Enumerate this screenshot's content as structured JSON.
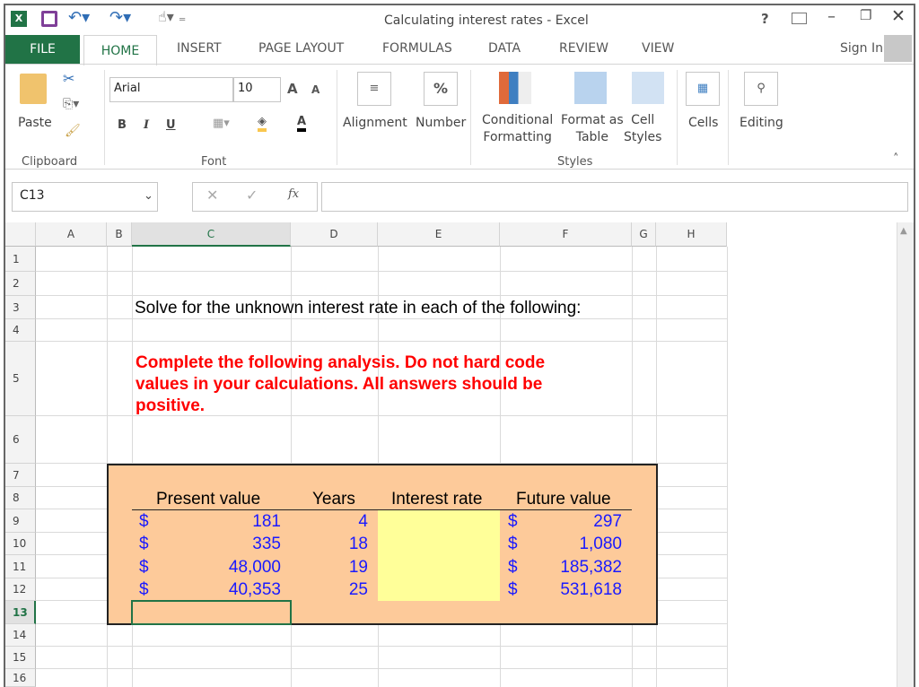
{
  "window": {
    "title": "Calculating interest rates - Excel",
    "sign_in": "Sign In"
  },
  "tabs": [
    "FILE",
    "HOME",
    "INSERT",
    "PAGE LAYOUT",
    "FORMULAS",
    "DATA",
    "REVIEW",
    "VIEW"
  ],
  "ribbon": {
    "paste": "Paste",
    "clipboard": "Clipboard",
    "font_name": "Arial",
    "font_size": "10",
    "bold": "B",
    "italic": "I",
    "underline": "U",
    "font": "Font",
    "alignment": "Alignment",
    "number": "Number",
    "percent": "%",
    "conditional": [
      "Conditional",
      "Formatting"
    ],
    "format_table": [
      "Format as",
      "Table"
    ],
    "cell_styles": [
      "Cell",
      "Styles"
    ],
    "styles": "Styles",
    "cells": "Cells",
    "editing": "Editing"
  },
  "formula_bar": {
    "name_box": "C13",
    "fx": "fx",
    "formula": ""
  },
  "columns": [
    "A",
    "B",
    "C",
    "D",
    "E",
    "F",
    "G",
    "H"
  ],
  "rows": [
    "1",
    "2",
    "3",
    "4",
    "5",
    "6",
    "7",
    "8",
    "9",
    "10",
    "11",
    "12",
    "13",
    "14",
    "15",
    "16"
  ],
  "sheet": {
    "instruction": "Solve for the unknown interest rate in each of the following:",
    "warning": "Complete the following analysis. Do not hard code values in your calculations. All answers should be positive.",
    "headers": [
      "Present value",
      "Years",
      "Interest rate",
      "Future value"
    ],
    "currency": "$",
    "table": [
      {
        "pv": "181",
        "years": "4",
        "rate": "",
        "fv": "297"
      },
      {
        "pv": "335",
        "years": "18",
        "rate": "",
        "fv": "1,080"
      },
      {
        "pv": "48,000",
        "years": "19",
        "rate": "",
        "fv": "185,382"
      },
      {
        "pv": "40,353",
        "years": "25",
        "rate": "",
        "fv": "531,618"
      }
    ]
  },
  "colors": {
    "excel_green": "#217346",
    "box_fill": "#fdca9a",
    "input_fill": "#ffff99",
    "warning": "#ff0000",
    "values": "#1a1aff"
  }
}
